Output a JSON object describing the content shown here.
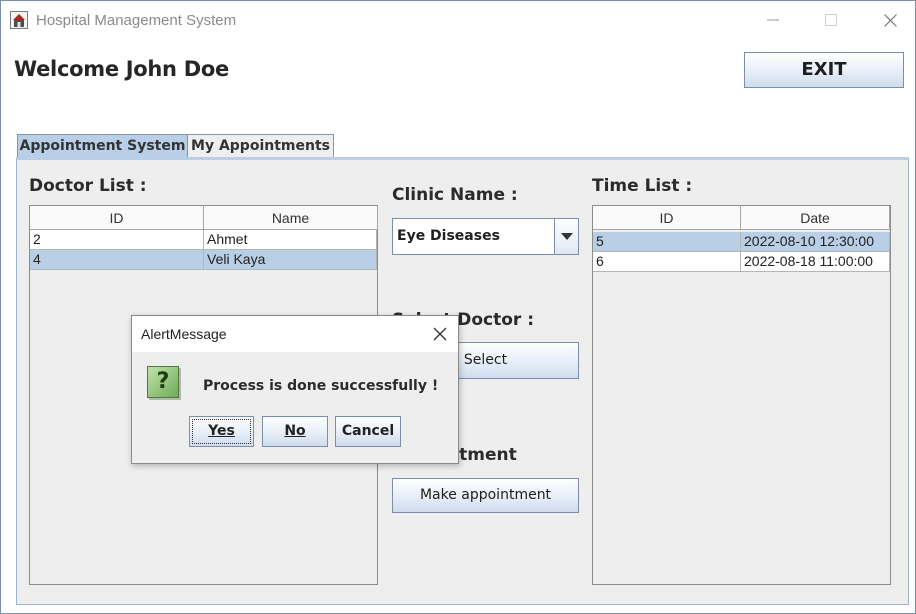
{
  "window": {
    "title": "Hospital Management System",
    "app_icon": "hospital-app-icon",
    "controls": [
      "minimize-icon",
      "maximize-icon",
      "close-icon"
    ]
  },
  "header": {
    "welcome": "Welcome John Doe",
    "exit_label": "EXIT"
  },
  "tabs": [
    {
      "label": "Appointment System",
      "active": true
    },
    {
      "label": "My Appointments",
      "active": false
    }
  ],
  "doctor_list": {
    "label": "Doctor List :",
    "columns": [
      "ID",
      "Name"
    ],
    "rows": [
      {
        "id": "2",
        "name": "Ahmet",
        "selected": false
      },
      {
        "id": "4",
        "name": "Veli Kaya",
        "selected": true
      }
    ]
  },
  "clinic": {
    "label": "Clinic Name :",
    "selected": "Eye Diseases"
  },
  "select_doctor": {
    "label": "Select Doctor :",
    "button": "Select"
  },
  "appointment": {
    "label": "Appointment",
    "button": "Make appointment"
  },
  "time_list": {
    "label": "Time List :",
    "columns": [
      "ID",
      "Date"
    ],
    "rows": [
      {
        "id": "5",
        "date": "2022-08-10 12:30:00",
        "selected": true
      },
      {
        "id": "6",
        "date": "2022-08-18 11:00:00",
        "selected": false
      }
    ]
  },
  "dialog": {
    "title": "AlertMessage",
    "icon": "question-icon",
    "message": "Process is done successfully !",
    "buttons": {
      "yes": "Yes",
      "no": "No",
      "cancel": "Cancel"
    }
  },
  "colors": {
    "selection": "#b8cfe5",
    "tab_active": "#b9cfe7",
    "panel_bg": "#eeeeee",
    "question_icon": "#6fa95a"
  }
}
